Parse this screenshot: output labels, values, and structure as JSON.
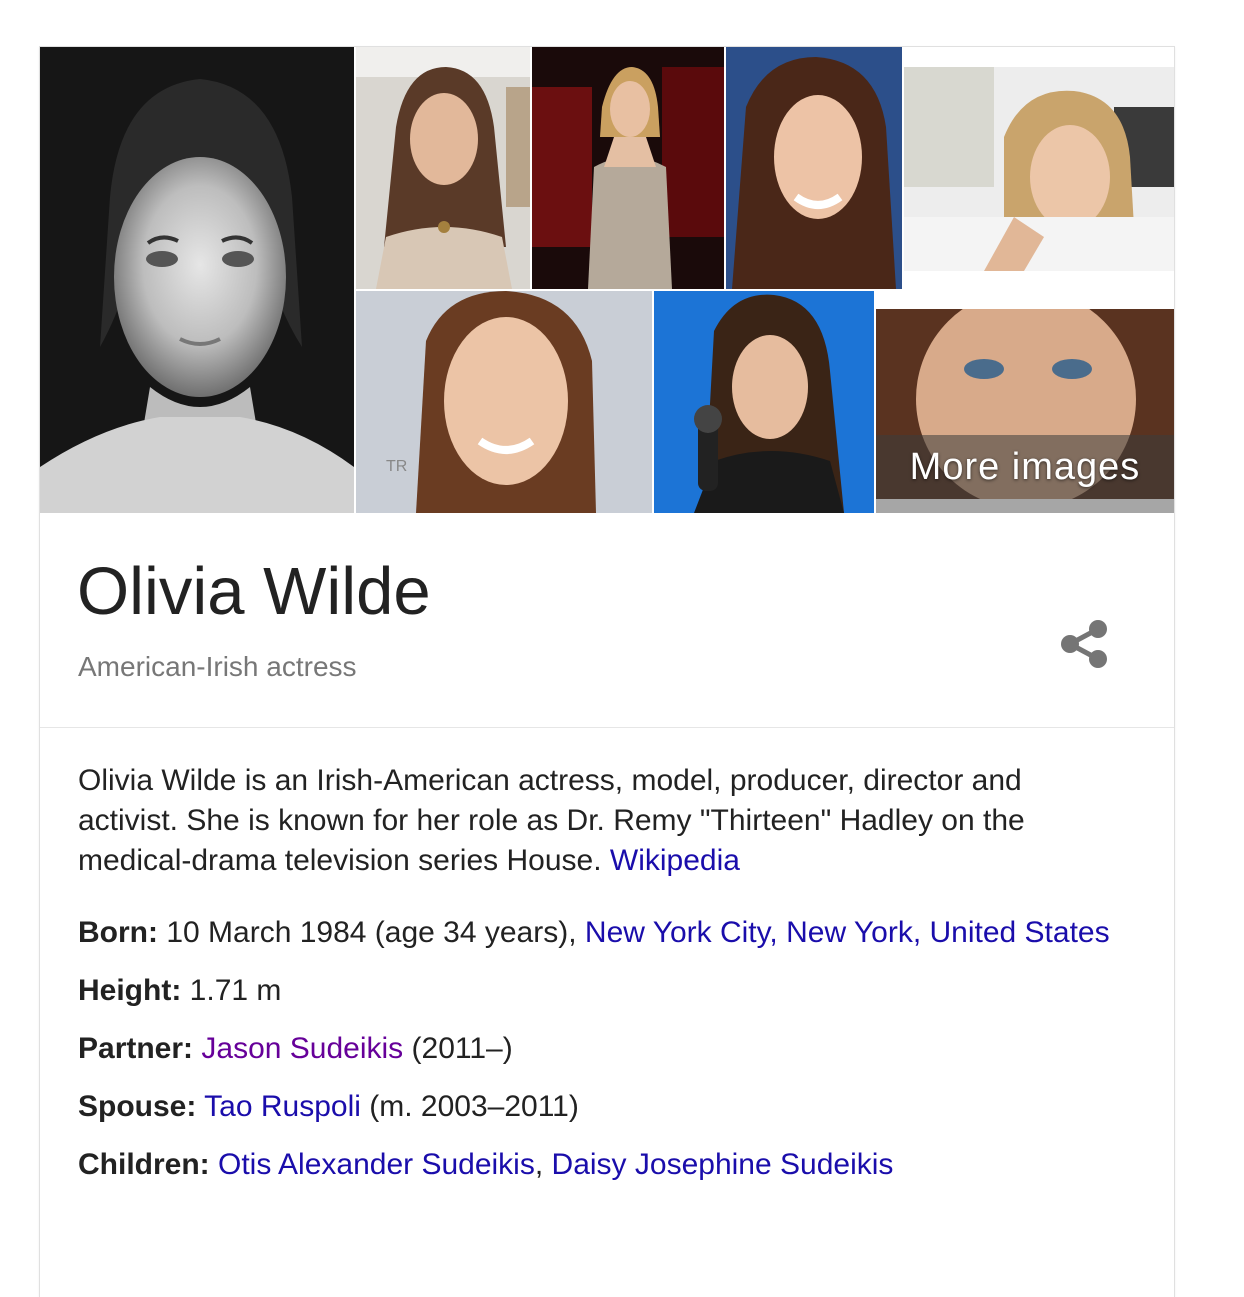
{
  "gallery": {
    "more_images_label": "More images"
  },
  "entity": {
    "title": "Olivia Wilde",
    "subtitle": "American-Irish actress"
  },
  "description": {
    "text": "Olivia Wilde is an Irish-American actress, model, producer, director and activist. She is known for her role as Dr. Remy \"Thirteen\" Hadley on the medical-drama television series House.",
    "source_link": "Wikipedia"
  },
  "facts": {
    "born": {
      "label": "Born:",
      "text": "10 March 1984 (age 34 years),",
      "place_link": "New York City, New York, United States"
    },
    "height": {
      "label": "Height:",
      "value": "1.71 m"
    },
    "partner": {
      "label": "Partner:",
      "link": "Jason Sudeikis",
      "suffix": "(2011–)"
    },
    "spouse": {
      "label": "Spouse:",
      "link": "Tao Ruspoli",
      "suffix": "(m. 2003–2011)"
    },
    "children": {
      "label": "Children:",
      "link1": "Otis Alexander Sudeikis",
      "separator": ",",
      "link2": "Daisy Josephine Sudeikis"
    }
  },
  "colors": {
    "link": "#1a0dab",
    "visited_link": "#660099",
    "title": "#222222",
    "subtitle": "#777777"
  },
  "icons": {
    "share": "share-icon"
  }
}
